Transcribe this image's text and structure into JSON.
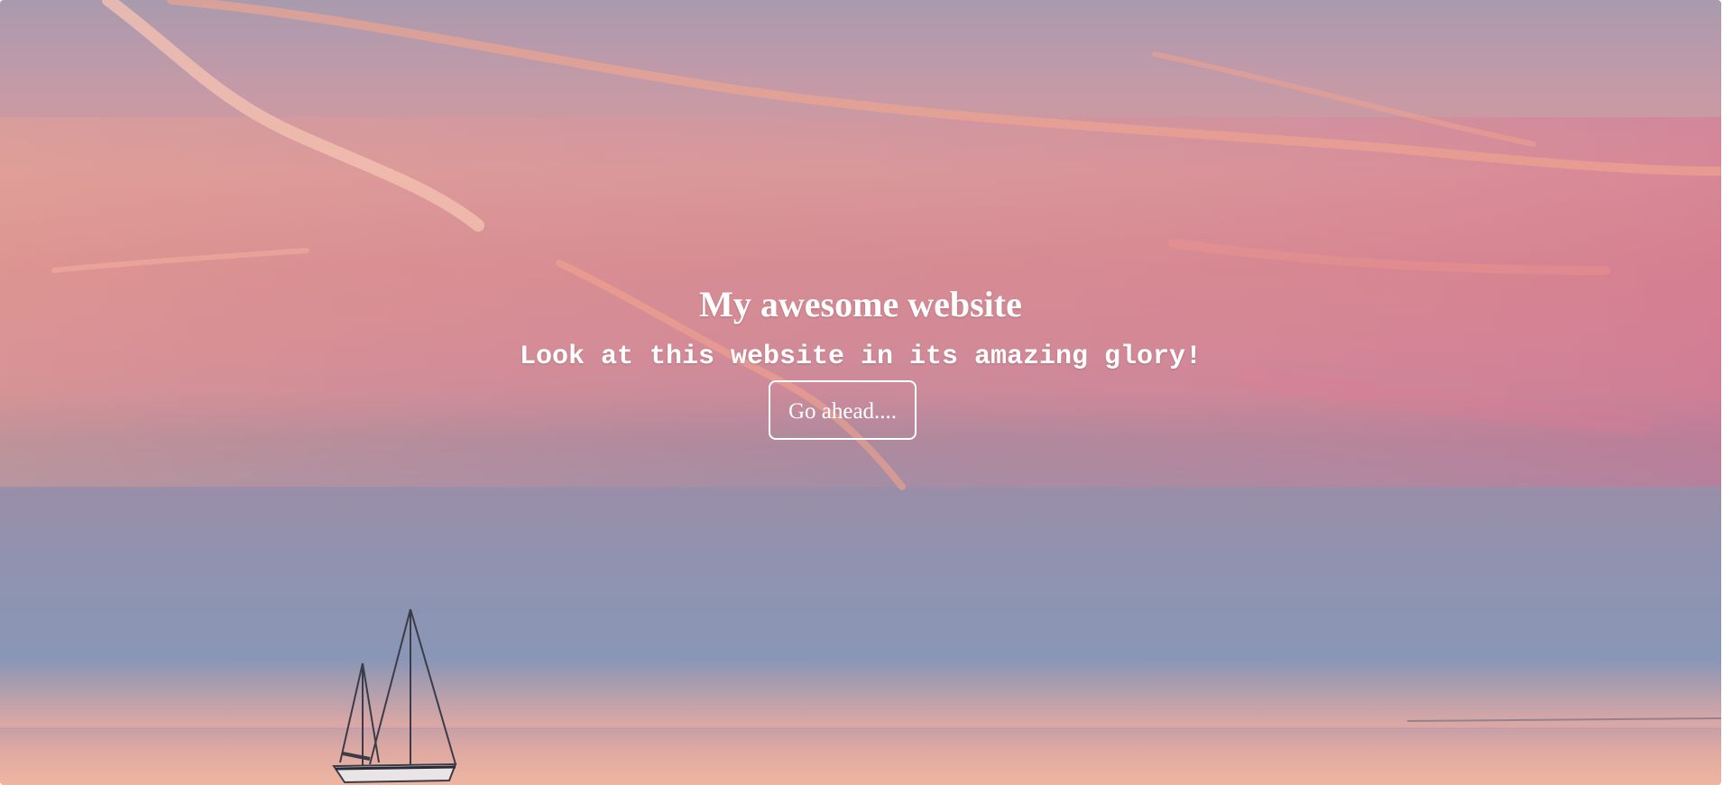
{
  "hero": {
    "title": "My awesome website",
    "subtitle": "Look at this website in its amazing glory!",
    "button_label": "Go ahead...."
  },
  "colors": {
    "text": "#ffffff",
    "sky_top": "#a99aae",
    "sky_pink": "#d38c93",
    "sky_low": "#8f93b0",
    "sea": "#e9b2a1"
  }
}
